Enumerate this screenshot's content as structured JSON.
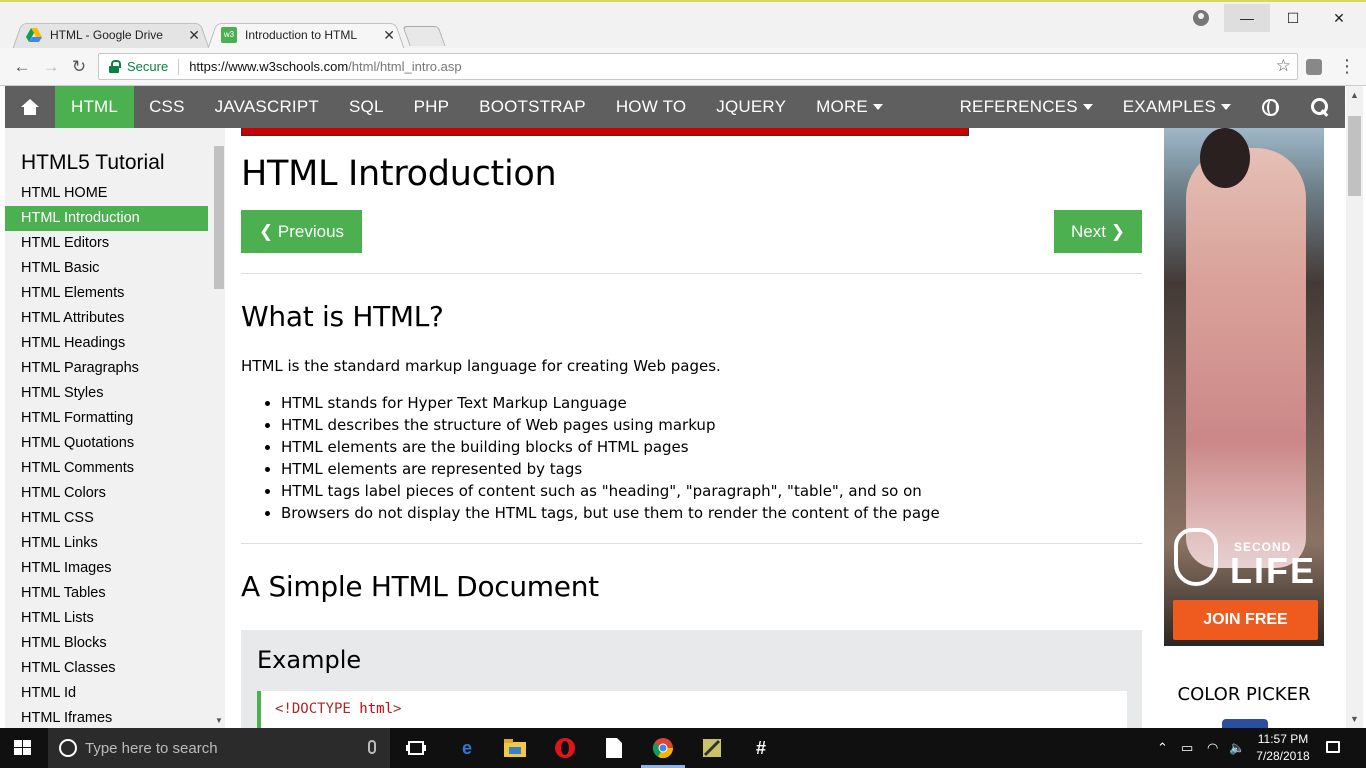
{
  "browser": {
    "tabs": [
      {
        "title": "HTML - Google Drive",
        "icon": "google-drive-icon"
      },
      {
        "title": "Introduction to HTML",
        "icon": "w3schools-icon"
      }
    ],
    "secure_label": "Secure",
    "url_host": "https://www.w3schools.com",
    "url_path": "/html/html_intro.asp"
  },
  "topnav": {
    "items": [
      "HTML",
      "CSS",
      "JAVASCRIPT",
      "SQL",
      "PHP",
      "BOOTSTRAP",
      "HOW TO",
      "JQUERY",
      "MORE"
    ],
    "right_items": [
      "REFERENCES",
      "EXAMPLES"
    ],
    "active_color": "#4caf50",
    "bar_color": "#5f5f5f"
  },
  "sidebar": {
    "title": "HTML5 Tutorial",
    "items": [
      "HTML HOME",
      "HTML Introduction",
      "HTML Editors",
      "HTML Basic",
      "HTML Elements",
      "HTML Attributes",
      "HTML Headings",
      "HTML Paragraphs",
      "HTML Styles",
      "HTML Formatting",
      "HTML Quotations",
      "HTML Comments",
      "HTML Colors",
      "HTML CSS",
      "HTML Links",
      "HTML Images",
      "HTML Tables",
      "HTML Lists",
      "HTML Blocks",
      "HTML Classes",
      "HTML Id",
      "HTML Iframes"
    ],
    "active_index": 1
  },
  "main": {
    "title": "HTML Introduction",
    "prev_label": "❮ Previous",
    "next_label": "Next ❯",
    "section1_title": "What is HTML?",
    "intro": "HTML is the standard markup language for creating Web pages.",
    "bullets": [
      "HTML stands for Hyper Text Markup Language",
      "HTML describes the structure of Web pages using markup",
      "HTML elements are the building blocks of HTML pages",
      "HTML elements are represented by tags",
      "HTML tags label pieces of content such as \"heading\", \"paragraph\", \"table\", and so on",
      "Browsers do not display the HTML tags, but use them to render the content of the page"
    ],
    "section2_title": "A Simple HTML Document",
    "example_title": "Example",
    "code_line": {
      "open": "<!DOCTYPE",
      "attr": "html",
      "close": ">"
    }
  },
  "ad": {
    "brand_top": "SECOND",
    "brand_bottom": "LIFE",
    "cta": "JOIN FREE"
  },
  "right": {
    "color_picker": "COLOR PICKER"
  },
  "taskbar": {
    "search_placeholder": "Type here to search",
    "time": "11:57 PM",
    "date": "7/28/2018"
  }
}
